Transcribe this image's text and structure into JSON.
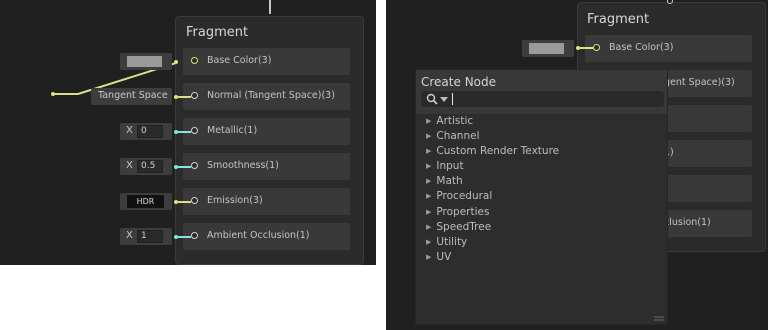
{
  "left": {
    "node_title": "Fragment",
    "ports": [
      {
        "label": "Base Color(3)"
      },
      {
        "label": "Normal (Tangent Space)(3)"
      },
      {
        "label": "Metallic(1)"
      },
      {
        "label": "Smoothness(1)"
      },
      {
        "label": "Emission(3)"
      },
      {
        "label": "Ambient Occlusion(1)"
      }
    ],
    "inputs": {
      "normal_space": "Tangent Space",
      "metallic": {
        "axis": "X",
        "value": "0"
      },
      "smoothness": {
        "axis": "X",
        "value": "0.5"
      },
      "emission": "HDR",
      "occlusion": {
        "axis": "X",
        "value": "1"
      }
    }
  },
  "right": {
    "node_title": "Fragment",
    "ports": [
      {
        "label": "Base Color(3)"
      },
      {
        "label": "gent Space)(3)"
      },
      {
        "label": "1)"
      },
      {
        "label": "clusion(1)"
      }
    ]
  },
  "create_node": {
    "title": "Create Node",
    "search_value": "",
    "categories": [
      "Artistic",
      "Channel",
      "Custom Render Texture",
      "Input",
      "Math",
      "Procedural",
      "Properties",
      "SpeedTree",
      "Utility",
      "UV"
    ]
  },
  "colors": {
    "vector3_port": "#e3e07a",
    "vector1_port": "#84e4e7",
    "background": "#202020",
    "node": "#2b2b2b"
  }
}
